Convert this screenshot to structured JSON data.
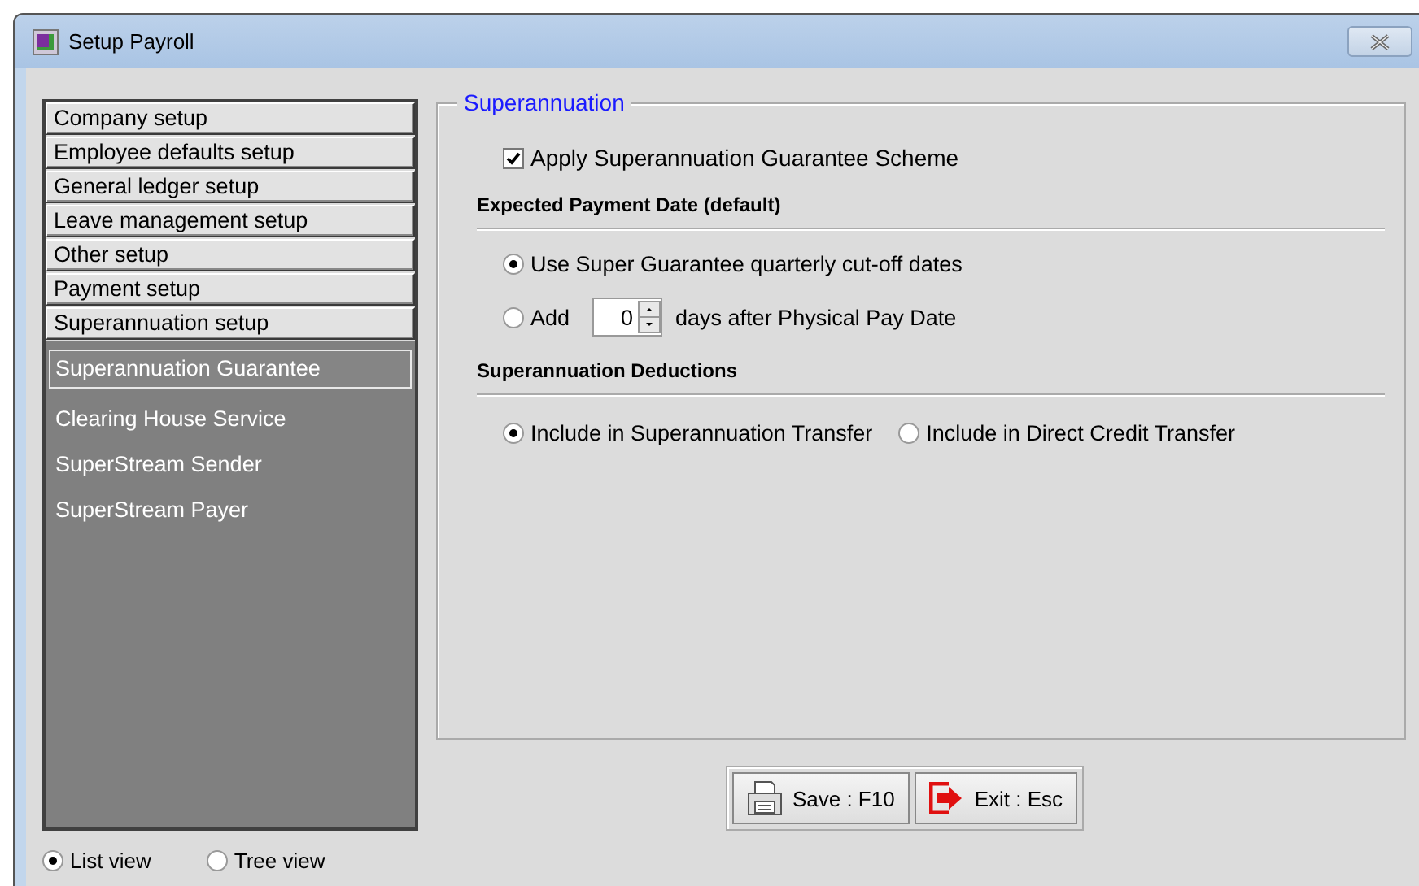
{
  "window": {
    "title": "Setup Payroll"
  },
  "sections": [
    {
      "label": "Company setup"
    },
    {
      "label": "Employee defaults setup"
    },
    {
      "label": "General ledger setup"
    },
    {
      "label": "Leave management setup"
    },
    {
      "label": "Other setup"
    },
    {
      "label": "Payment setup"
    },
    {
      "label": "Superannuation setup"
    }
  ],
  "subitems": [
    {
      "label": "Superannuation Guarantee",
      "selected": true
    },
    {
      "label": "Clearing House Service",
      "selected": false
    },
    {
      "label": "SuperStream Sender",
      "selected": false
    },
    {
      "label": "SuperStream Payer",
      "selected": false
    }
  ],
  "view_options": [
    {
      "label": "List view",
      "selected": true
    },
    {
      "label": "Tree view",
      "selected": false
    }
  ],
  "group": {
    "title": "Superannuation",
    "apply_scheme": {
      "label": "Apply Superannuation Guarantee Scheme",
      "checked": true
    },
    "payment_date": {
      "heading": "Expected Payment Date (default)",
      "options": [
        {
          "kind": "plain",
          "label": "Use Super Guarantee quarterly cut-off dates",
          "selected": true
        },
        {
          "kind": "days",
          "label": "Add",
          "value": "0",
          "suffix": "days after Physical Pay Date",
          "selected": false
        }
      ]
    },
    "deductions": {
      "heading": "Superannuation Deductions",
      "options": [
        {
          "label": "Include in Superannuation Transfer",
          "selected": true
        },
        {
          "label": "Include in Direct Credit Transfer",
          "selected": false
        }
      ]
    }
  },
  "buttons": [
    {
      "kind": "save",
      "label": "Save : F10"
    },
    {
      "kind": "exit",
      "label": "Exit : Esc"
    }
  ]
}
